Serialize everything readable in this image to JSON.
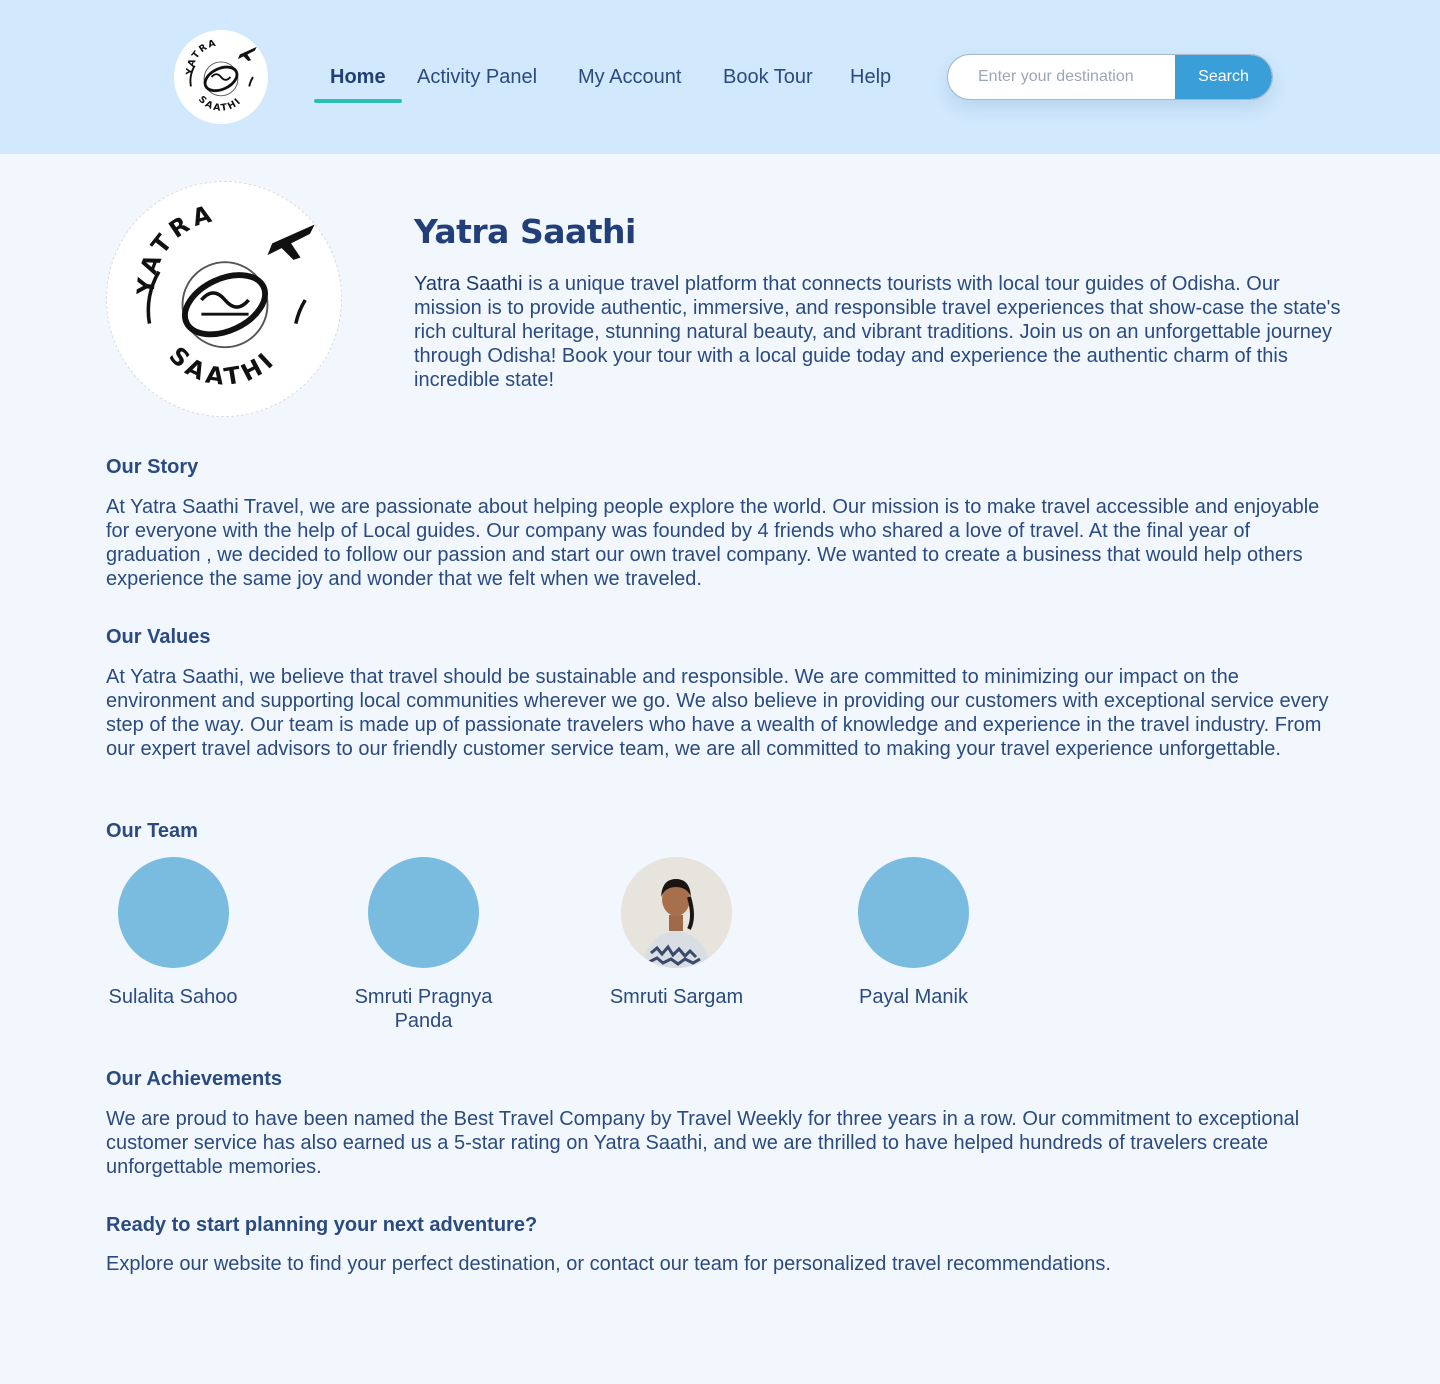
{
  "header": {
    "logo_alt": "Yatra Saathi logo",
    "nav": [
      {
        "label": "Home",
        "active": true
      },
      {
        "label": "Activity Panel",
        "active": false
      },
      {
        "label": "My Account",
        "active": false
      },
      {
        "label": "Book Tour",
        "active": false
      },
      {
        "label": "Help",
        "active": false
      }
    ],
    "search": {
      "placeholder": "Enter your destination",
      "value": "",
      "button_label": "Search"
    }
  },
  "hero": {
    "logo_top_text": "YATRA",
    "logo_bottom_text": "SAATHI",
    "title": "Yatra Saathi",
    "brand": "Yatra Saathi",
    "description": " is a unique travel platform that connects tourists with local tour guides of Odisha. Our mission is to provide authentic, immersive, and responsible travel experiences that show-case the state's rich cultural heritage, stunning natural beauty, and vibrant traditions. Join us on an unforgettable journey through Odisha! Book your tour with a local guide today and experience the authentic charm of this incredible state!"
  },
  "story": {
    "title": "Our Story",
    "text": "At Yatra Saathi Travel, we are passionate about helping people explore the world. Our mission is to make travel accessible and enjoyable for everyone with the help of Local guides. Our company was founded by 4 friends who shared a love of travel. At the final year of graduation , we decided to follow our passion and start our own travel company. We wanted to create a business that would help others experience the same joy and wonder that we felt when we traveled."
  },
  "values": {
    "title": "Our Values",
    "text": "At Yatra Saathi, we believe that travel should be sustainable and responsible. We are committed to minimizing our impact on the environment and supporting local communities wherever we go. We also believe in providing our customers with exceptional service every step of the way. Our team is made up of passionate travelers who have a wealth of knowledge and experience in the travel industry. From our expert travel advisors to our friendly customer service team, we are all committed to making your travel experience unforgettable."
  },
  "team": {
    "title": "Our Team",
    "members": [
      {
        "name": "Sulalita Sahoo",
        "has_photo": false
      },
      {
        "name": "Smruti Pragnya Panda",
        "has_photo": false
      },
      {
        "name": "Smruti Sargam",
        "has_photo": true
      },
      {
        "name": "Payal Manik",
        "has_photo": false
      }
    ]
  },
  "achievements": {
    "title": "Our Achievements",
    "text": "We are proud to have been named the Best Travel Company by Travel Weekly for three years in a row. Our commitment to exceptional customer service has also earned us a 5-star rating on Yatra Saathi, and we are thrilled to have helped hundreds of travelers create unforgettable memories."
  },
  "cta": {
    "title": "Ready to start planning your next adventure?",
    "text": "Explore our website to find your perfect destination, or contact our team for personalized travel recommendations."
  },
  "colors": {
    "header_bg": "#d2e9fd",
    "page_bg": "#f2f7fe",
    "accent": "#3a9fd8",
    "active_underline": "#2bbfb2",
    "avatar_placeholder": "#7abbe0",
    "text": "#2a4a80"
  }
}
